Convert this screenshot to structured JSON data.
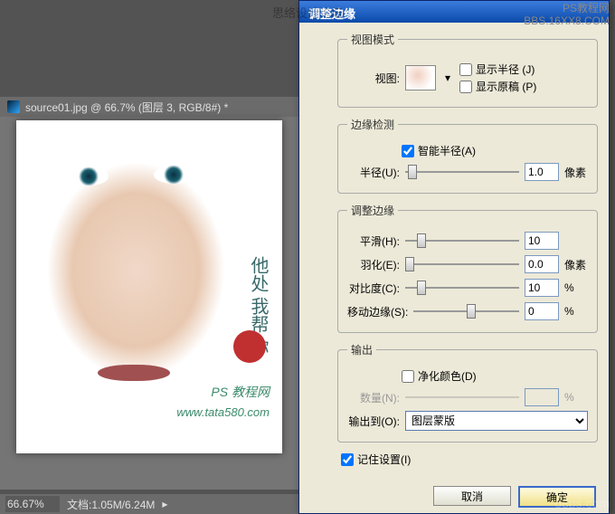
{
  "overlay": {
    "site": "思络设计论坛",
    "pstut": "PS教程网",
    "url": "BBS.16XX8.COM",
    "footer": "68ps.com"
  },
  "doc": {
    "tab": "source01.jpg @ 66.7% (图层 3, RGB/8#) *",
    "zoom": "66.67%",
    "status": "文档:1.05M/6.24M"
  },
  "canvas": {
    "wm_cn": "他处\n我帮\n你",
    "wm_ps": "PS 教程网",
    "wm_url": "www.tata580.com"
  },
  "dialog": {
    "title": "调整边缘",
    "view_mode": {
      "legend": "视图模式",
      "view_label": "视图:",
      "show_radius": "显示半径 (J)",
      "show_original": "显示原稿 (P)"
    },
    "edge_detection": {
      "legend": "边缘检测",
      "smart_radius": "智能半径(A)",
      "radius_label": "半径(U):",
      "radius_value": "1.0",
      "radius_unit": "像素"
    },
    "adjust_edge": {
      "legend": "调整边缘",
      "smooth_label": "平滑(H):",
      "smooth_value": "10",
      "feather_label": "羽化(E):",
      "feather_value": "0.0",
      "feather_unit": "像素",
      "contrast_label": "对比度(C):",
      "contrast_value": "10",
      "contrast_unit": "%",
      "shift_label": "移动边缘(S):",
      "shift_value": "0",
      "shift_unit": "%"
    },
    "output": {
      "legend": "输出",
      "decontaminate": "净化颜色(D)",
      "amount_label": "数量(N):",
      "amount_unit": "%",
      "output_to_label": "输出到(O):",
      "output_to_value": "图层蒙版"
    },
    "remember": "记住设置(I)",
    "cancel": "取消",
    "ok": "确定"
  }
}
